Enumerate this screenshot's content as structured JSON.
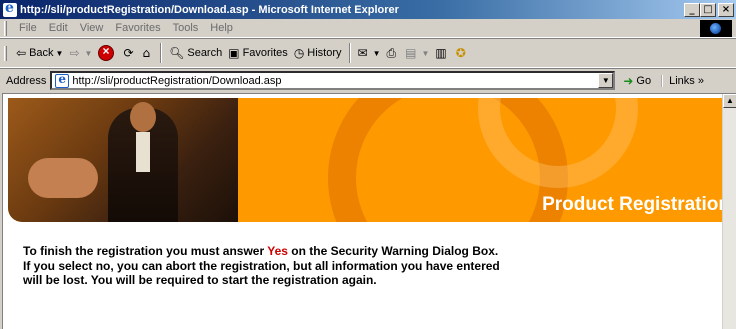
{
  "window": {
    "title": "http://sli/productRegistration/Download.asp - Microsoft Internet Explorer",
    "minimize_glyph": "_",
    "maximize_glyph": "□",
    "close_glyph": "×"
  },
  "menu": [
    "File",
    "Edit",
    "View",
    "Favorites",
    "Tools",
    "Help"
  ],
  "toolbar": {
    "back_label": "Back",
    "search_label": "Search",
    "favorites_label": "Favorites",
    "history_label": "History"
  },
  "address": {
    "label": "Address",
    "url": "http://sli/productRegistration/Download.asp",
    "go_label": "Go",
    "links_label": "Links »"
  },
  "banner": {
    "title": "Product Registration"
  },
  "content": {
    "line1_before": "To finish the registration you must answer ",
    "line1_highlight": "Yes",
    "line1_after": " on the Security Warning Dialog Box.",
    "line2": "If you select no, you can abort the registration, but all information you have entered",
    "line3": "will be lost. You will be required to start the registration again."
  },
  "colors": {
    "banner_orange": "#ff9900",
    "highlight_red": "#cc0000"
  }
}
